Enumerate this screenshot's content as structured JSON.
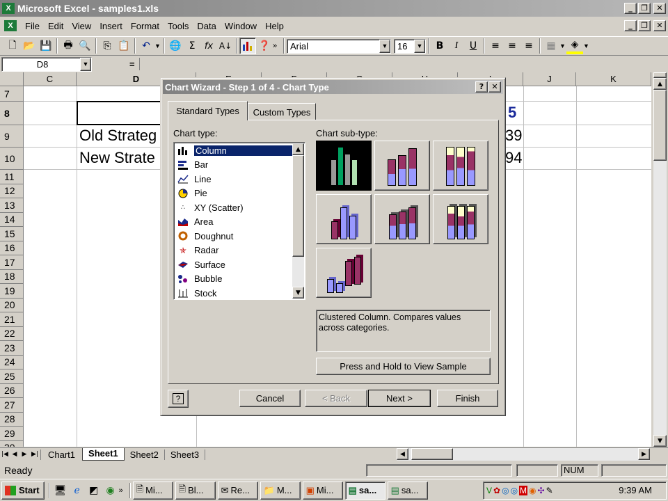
{
  "window": {
    "title": "Microsoft Excel - samples1.xls",
    "min": "_",
    "restore": "❐",
    "close": "✕"
  },
  "menu": [
    "File",
    "Edit",
    "View",
    "Insert",
    "Format",
    "Tools",
    "Data",
    "Window",
    "Help"
  ],
  "toolbar": {
    "font": "Arial",
    "size": "16",
    "bold": "B",
    "italic": "I",
    "underline": "U",
    "sum": "Σ",
    "fx": "fx"
  },
  "formula": {
    "namebox": "D8",
    "equals": "="
  },
  "columns": [
    "C",
    "D",
    "E",
    "F",
    "G",
    "H",
    "I",
    "J",
    "K"
  ],
  "rows": [
    "7",
    "8",
    "9",
    "10",
    "11",
    "12",
    "13",
    "14",
    "15",
    "16",
    "17",
    "18",
    "19",
    "20",
    "21",
    "22",
    "23",
    "24",
    "25",
    "26",
    "27",
    "28",
    "29",
    "30"
  ],
  "cells": {
    "d9": "Old Strateg",
    "d10": "New Strate",
    "i8": "5",
    "i9": "39",
    "i10": "94"
  },
  "sheets": [
    "Chart1",
    "Sheet1",
    "Sheet2",
    "Sheet3"
  ],
  "status": {
    "ready": "Ready",
    "num": "NUM"
  },
  "dialog": {
    "title": "Chart Wizard - Step 1 of 4 - Chart Type",
    "help_btn": "?",
    "close_btn": "✕",
    "tabs": [
      "Standard Types",
      "Custom Types"
    ],
    "chart_type_label": "Chart type:",
    "subtype_label": "Chart sub-type:",
    "chart_types": [
      "Column",
      "Bar",
      "Line",
      "Pie",
      "XY (Scatter)",
      "Area",
      "Doughnut",
      "Radar",
      "Surface",
      "Bubble",
      "Stock"
    ],
    "selected_type": "Column",
    "description": "Clustered Column. Compares values across categories.",
    "press_hold": "Press and Hold to View Sample",
    "buttons": {
      "cancel": "Cancel",
      "back": "< Back",
      "next": "Next >",
      "finish": "Finish"
    }
  },
  "taskbar": {
    "start": "Start",
    "items": [
      "Mi...",
      "Bl...",
      "Re...",
      "M...",
      "Mi...",
      "sa...",
      "sa..."
    ],
    "clock": "9:39 AM"
  }
}
